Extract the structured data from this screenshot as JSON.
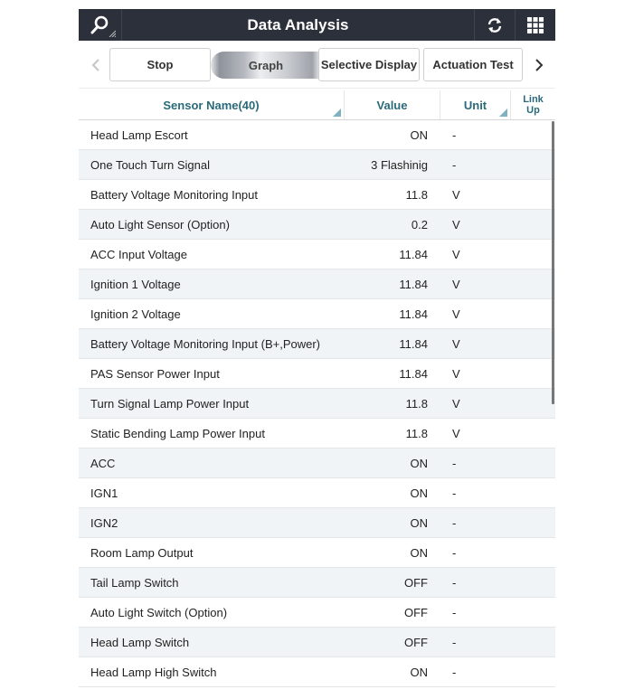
{
  "header": {
    "title": "Data Analysis",
    "left_icon": "search-icon",
    "right_icons": [
      "refresh-icon",
      "grid-menu-icon"
    ]
  },
  "toolbar": {
    "prev_icon": "chevron-left-icon",
    "next_icon": "chevron-right-icon",
    "buttons": [
      {
        "label": "Stop"
      },
      {
        "label": "Graph"
      },
      {
        "label": "Selective Display"
      },
      {
        "label": "Actuation Test"
      }
    ]
  },
  "table": {
    "columns": {
      "name": "Sensor Name(40)",
      "value": "Value",
      "unit": "Unit",
      "link_up": "Link Up"
    },
    "rows": [
      {
        "name": "Head Lamp Escort",
        "value": "ON",
        "unit": "-"
      },
      {
        "name": "One Touch Turn Signal",
        "value": "3 Flashinig",
        "unit": "-"
      },
      {
        "name": "Battery Voltage Monitoring Input",
        "value": "11.8",
        "unit": "V"
      },
      {
        "name": "Auto Light Sensor (Option)",
        "value": "0.2",
        "unit": "V"
      },
      {
        "name": "ACC Input Voltage",
        "value": "11.84",
        "unit": "V"
      },
      {
        "name": "Ignition 1 Voltage",
        "value": "11.84",
        "unit": "V"
      },
      {
        "name": "Ignition 2 Voltage",
        "value": "11.84",
        "unit": "V"
      },
      {
        "name": "Battery Voltage Monitoring Input (B+,Power)",
        "value": "11.84",
        "unit": "V"
      },
      {
        "name": "PAS Sensor Power Input",
        "value": "11.84",
        "unit": "V"
      },
      {
        "name": "Turn Signal Lamp Power Input",
        "value": "11.8",
        "unit": "V"
      },
      {
        "name": "Static Bending Lamp Power Input",
        "value": "11.8",
        "unit": "V"
      },
      {
        "name": "ACC",
        "value": "ON",
        "unit": "-"
      },
      {
        "name": "IGN1",
        "value": "ON",
        "unit": "-"
      },
      {
        "name": "IGN2",
        "value": "ON",
        "unit": "-"
      },
      {
        "name": "Room Lamp Output",
        "value": "ON",
        "unit": "-"
      },
      {
        "name": "Tail Lamp Switch",
        "value": "OFF",
        "unit": "-"
      },
      {
        "name": "Auto Light Switch (Option)",
        "value": "OFF",
        "unit": "-"
      },
      {
        "name": "Head Lamp Switch",
        "value": "OFF",
        "unit": "-"
      },
      {
        "name": "Head Lamp High Switch",
        "value": "ON",
        "unit": "-"
      }
    ]
  },
  "colors": {
    "titlebar_bg": "#2b303b",
    "header_text": "#2a6a7a",
    "row_alt_bg": "#f1f4f6"
  }
}
